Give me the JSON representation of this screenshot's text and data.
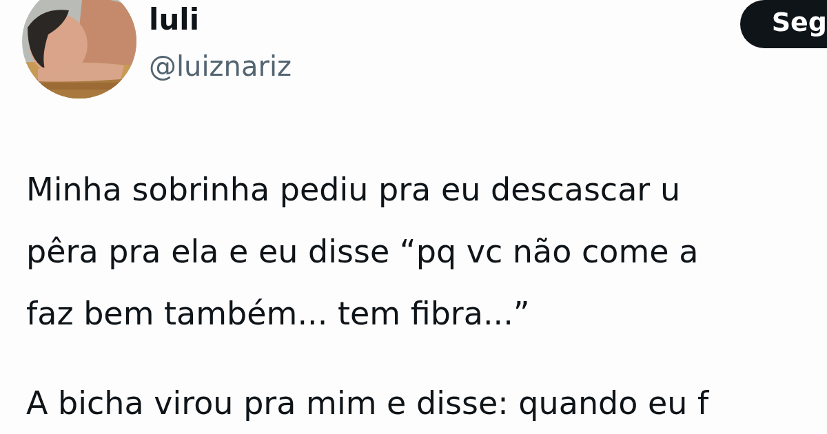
{
  "author": {
    "name": "luli",
    "handle": "@luiznariz"
  },
  "follow_button": {
    "label": "Seg"
  },
  "paragraphs": [
    {
      "lines": [
        "Minha sobrinha pediu pra eu descascar u",
        "pêra pra ela e eu disse “pq vc não come a",
        "faz bem também... tem fibra...”"
      ]
    },
    {
      "lines": [
        "A bicha virou pra mim e disse: quando eu f"
      ]
    }
  ]
}
